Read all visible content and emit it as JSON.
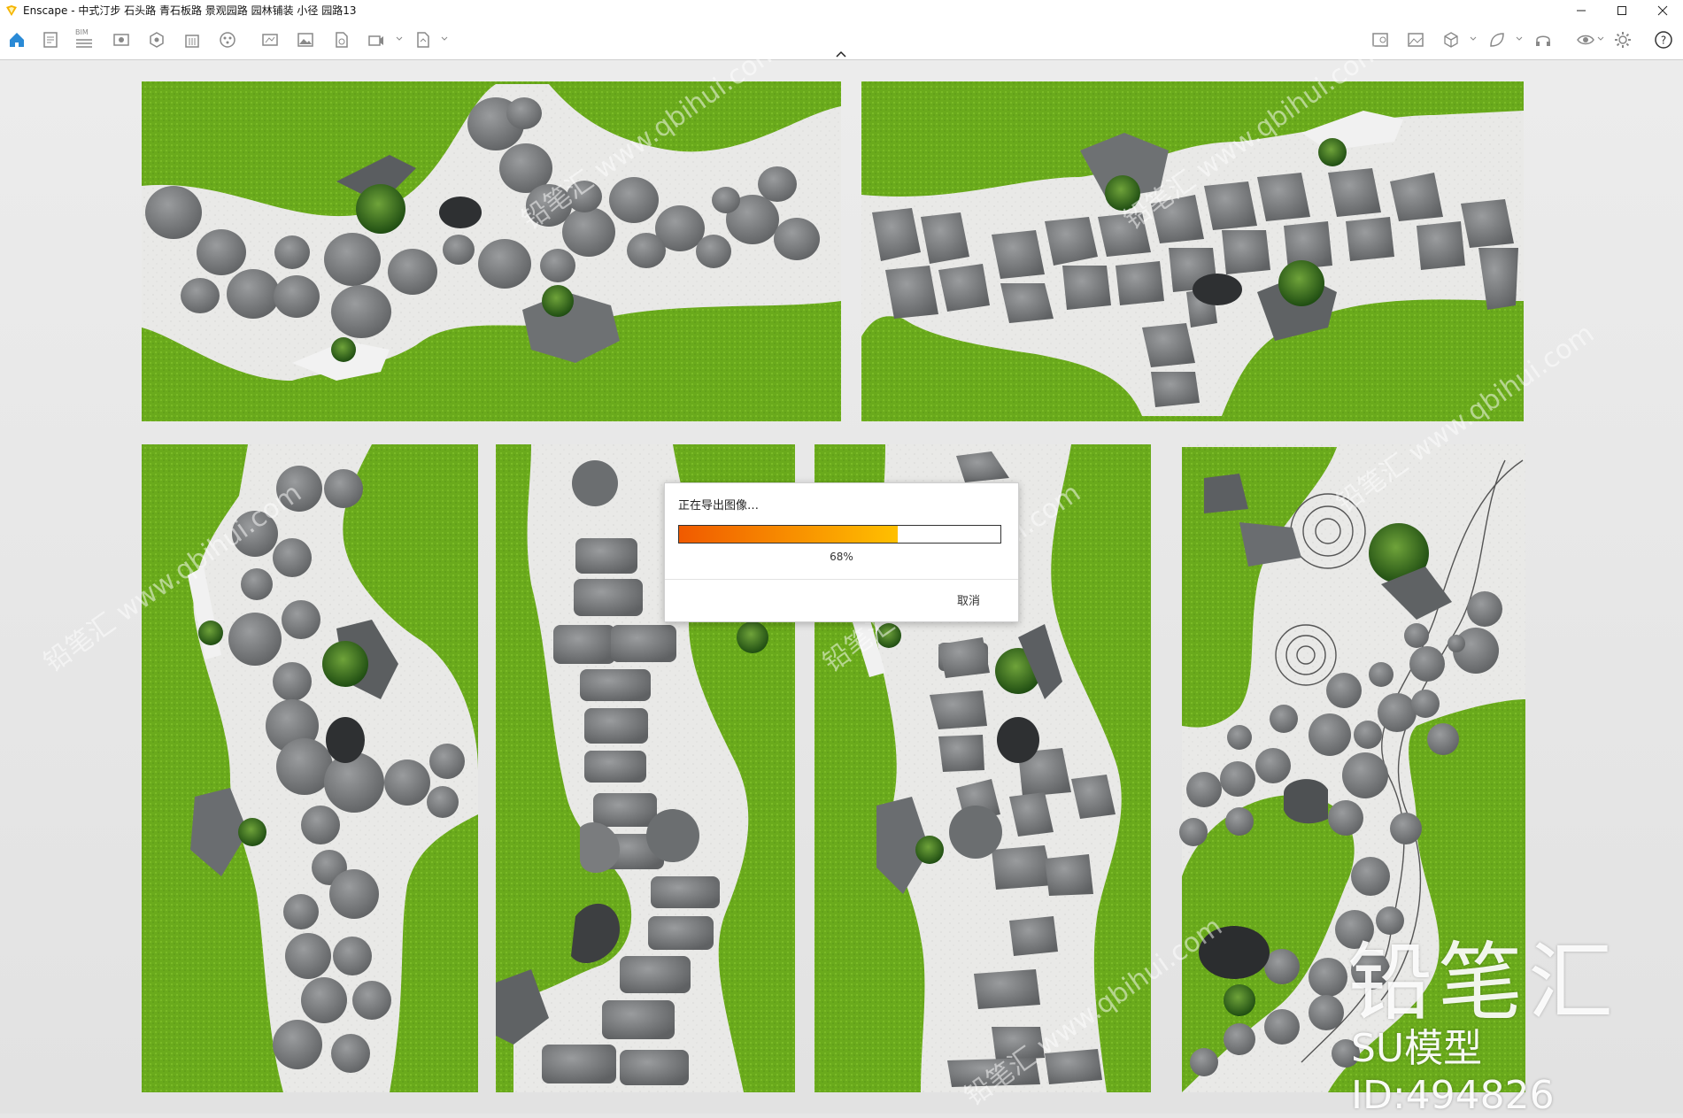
{
  "window": {
    "title": "Enscape - 中式汀步 石头路 青石板路 景观园路 园林铺装 小径 园路13",
    "minimize_icon": "minimize-icon",
    "maximize_icon": "maximize-icon",
    "close_icon": "close-icon"
  },
  "toolbar": {
    "left_icons": [
      "home-icon",
      "document-icon",
      "bim-icon",
      "visual-settings-icon",
      "view-management-icon",
      "building-icon",
      "asset-library-icon",
      "screenshot-icon",
      "render-image-icon",
      "batch-render-icon",
      "video-icon",
      "export-icon"
    ],
    "right_icons": [
      "map-icon",
      "image-icon",
      "cube-icon",
      "leaf-icon",
      "headset-icon",
      "eye-icon",
      "settings-icon",
      "help-icon"
    ],
    "bim_label": "BIM"
  },
  "dialog": {
    "title": "正在导出图像…",
    "progress": 0.68,
    "progress_label": "68%",
    "cancel_label": "取消"
  },
  "watermark": {
    "brand": "铅笔汇",
    "model_id": "SU模型ID:494826",
    "tiled": [
      "铅笔汇 www.qbihui.com"
    ]
  },
  "colors": {
    "progress_start": "#f05a00",
    "progress_end": "#ffc000",
    "grass": "#6fae1f",
    "gravel": "#e6e6e4",
    "stone": "#7b7d7f"
  }
}
